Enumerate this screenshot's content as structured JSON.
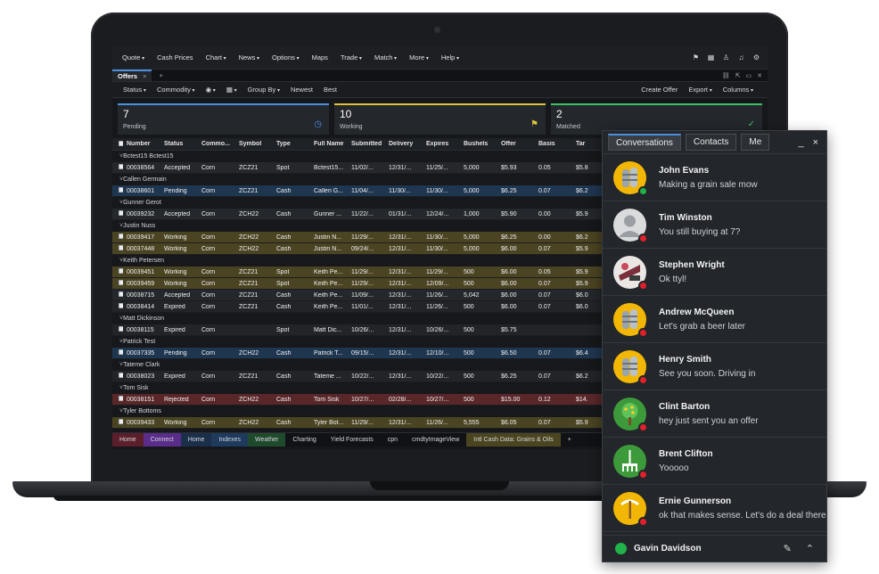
{
  "menu": [
    "Quote",
    "Cash Prices",
    "Chart",
    "News",
    "Options",
    "Maps",
    "Trade",
    "Match",
    "More",
    "Help"
  ],
  "menu_dropdown": [
    true,
    false,
    true,
    true,
    true,
    false,
    true,
    true,
    true,
    true
  ],
  "menu_icons": [
    "flag-icon",
    "grid-icon",
    "user-icon",
    "bell-icon",
    "gear-icon"
  ],
  "tab": {
    "label": "Offers",
    "close": "×",
    "add": "+"
  },
  "toolbar": {
    "left": [
      "Status",
      "Commodity",
      "◉",
      "▦",
      "Group By",
      "Newest",
      "Best"
    ],
    "left_dropdown": [
      true,
      true,
      true,
      true,
      true,
      false,
      false
    ],
    "right": [
      "Create Offer",
      "Export",
      "Columns"
    ],
    "right_dropdown": [
      false,
      true,
      true
    ]
  },
  "cards": [
    {
      "count": "7",
      "label": "Pending",
      "color": "#4a90e2",
      "icon": "clock-icon"
    },
    {
      "count": "10",
      "label": "Working",
      "color": "#d9c43a",
      "icon": "flag-icon"
    },
    {
      "count": "2",
      "label": "Matched",
      "color": "#3cbf6a",
      "icon": "check-circle-icon"
    }
  ],
  "columns": [
    "Number",
    "Status",
    "Commo...",
    "Symbol",
    "Type",
    "Full Name",
    "Submitted",
    "Delivery",
    "Expires",
    "Bushels",
    "Offer",
    "Basis",
    "Tar"
  ],
  "groups": [
    {
      "name": "Bctest15 Bctest15",
      "rows": [
        [
          "00038564",
          "Accepted",
          "Corn",
          "ZCZ21",
          "Spot",
          "Bctest15...",
          "11/02/...",
          "12/31/...",
          "11/25/...",
          "5,000",
          "$5.93",
          "0.05",
          "$5.8"
        ]
      ]
    },
    {
      "name": "Callen Germain",
      "rows": [
        [
          "00038601",
          "Pending",
          "Corn",
          "ZCZ21",
          "Cash",
          "Callen G...",
          "11/04/...",
          "11/30/...",
          "11/30/...",
          "5,000",
          "$6.25",
          "0.07",
          "$6.2"
        ]
      ]
    },
    {
      "name": "Gunner Gerot",
      "rows": [
        [
          "00039232",
          "Accepted",
          "Corn",
          "ZCH22",
          "Cash",
          "Gunner ...",
          "11/22/...",
          "01/31/...",
          "12/24/...",
          "1,000",
          "$5.90",
          "0.00",
          "$5.9"
        ]
      ]
    },
    {
      "name": "Justin Nuss",
      "rows": [
        [
          "00039417",
          "Working",
          "Corn",
          "ZCH22",
          "Cash",
          "Justin N...",
          "11/29/...",
          "12/31/...",
          "11/30/...",
          "5,000",
          "$6.25",
          "0.00",
          "$6.2"
        ],
        [
          "00037448",
          "Working",
          "Corn",
          "ZCH22",
          "Cash",
          "Justin N...",
          "09/24/...",
          "12/31/...",
          "11/30/...",
          "5,000",
          "$6.00",
          "0.07",
          "$5.9"
        ]
      ]
    },
    {
      "name": "Keith Petersen",
      "rows": [
        [
          "00039451",
          "Working",
          "Corn",
          "ZCZ21",
          "Spot",
          "Keith Pe...",
          "11/29/...",
          "12/31/...",
          "11/29/...",
          "500",
          "$6.00",
          "0.05",
          "$5.9"
        ],
        [
          "00039459",
          "Working",
          "Corn",
          "ZCZ21",
          "Spot",
          "Keith Pe...",
          "11/29/...",
          "12/31/...",
          "12/09/...",
          "500",
          "$6.00",
          "0.07",
          "$5.9"
        ],
        [
          "00038715",
          "Accepted",
          "Corn",
          "ZCZ21",
          "Cash",
          "Keith Pe...",
          "11/09/...",
          "12/31/...",
          "11/26/...",
          "5,042",
          "$6.00",
          "0.07",
          "$6.0"
        ],
        [
          "00038414",
          "Expired",
          "Corn",
          "ZCZ21",
          "Cash",
          "Keith Pe...",
          "11/01/...",
          "12/31/...",
          "11/26/...",
          "500",
          "$6.00",
          "0.07",
          "$6.0"
        ]
      ]
    },
    {
      "name": "Matt Dickinson",
      "rows": [
        [
          "00038115",
          "Expired",
          "Corn",
          "",
          "Spot",
          "Matt Dic...",
          "10/26/...",
          "12/31/...",
          "10/26/...",
          "500",
          "$5.75",
          "",
          ""
        ]
      ]
    },
    {
      "name": "Patrick Test",
      "rows": [
        [
          "00037335",
          "Pending",
          "Corn",
          "ZCH22",
          "Cash",
          "Patrick T...",
          "09/15/...",
          "12/31/...",
          "12/10/...",
          "500",
          "$6.50",
          "0.07",
          "$6.4"
        ]
      ]
    },
    {
      "name": "Tateme Clark",
      "rows": [
        [
          "00038023",
          "Expired",
          "Corn",
          "ZCZ21",
          "Cash",
          "Tateme ...",
          "10/22/...",
          "12/31/...",
          "10/22/...",
          "500",
          "$6.25",
          "0.07",
          "$6.2"
        ]
      ]
    },
    {
      "name": "Tom Sisk",
      "rows": [
        [
          "00038151",
          "Rejected",
          "Corn",
          "ZCH22",
          "Cash",
          "Tom Sisk",
          "10/27/...",
          "02/28/...",
          "10/27/...",
          "500",
          "$15.00",
          "0.12",
          "$14."
        ]
      ]
    },
    {
      "name": "Tyler Bottoms",
      "rows": [
        [
          "00039433",
          "Working",
          "Corn",
          "ZCH22",
          "Cash",
          "Tyler Bot...",
          "11/29/...",
          "12/31/...",
          "11/26/...",
          "5,555",
          "$6.05",
          "0.07",
          "$5.9"
        ]
      ]
    }
  ],
  "status_colors": {
    "Pending": "#1f3650",
    "Accepted": "#24272b",
    "Working": "#4b4422",
    "Matched": "#1d4230",
    "Expired": "#222428",
    "Rejected": "#5a2729"
  },
  "bottom_tabs": [
    {
      "label": "Home",
      "color": "#5b1f2b"
    },
    {
      "label": "Connect",
      "color": "#5a2d8a"
    },
    {
      "label": "Home",
      "color": "#1b2f4a"
    },
    {
      "label": "Indexes",
      "color": "#1e3a5c"
    },
    {
      "label": "Weather",
      "color": "#1f4a2c"
    },
    {
      "label": "Charting",
      "color": "#101215"
    },
    {
      "label": "Yield Forecasts",
      "color": "#101215"
    },
    {
      "label": "cpn",
      "color": "#101215"
    },
    {
      "label": "cmdtyImageView",
      "color": "#101215"
    },
    {
      "label": "Intl Cash Data: Grains & Oils",
      "color": "#4a4520"
    },
    {
      "label": "+",
      "color": "#101215"
    }
  ],
  "chat": {
    "tabs": [
      "Conversations",
      "Contacts",
      "Me"
    ],
    "window_icons": {
      "minimize": "_",
      "close": "×"
    },
    "conversations": [
      {
        "name": "John Evans",
        "message": "Making a grain sale mow",
        "avatar": "silo",
        "status": "#21b24a"
      },
      {
        "name": "Tim Winston",
        "message": "You still buying at 7?",
        "avatar": "person",
        "status": "#e0202a"
      },
      {
        "name": "Stephen Wright",
        "message": "Ok ttyl!",
        "avatar": "photo",
        "status": "#e0202a"
      },
      {
        "name": "Andrew McQueen",
        "message": "Let's grab a beer later",
        "avatar": "silo",
        "status": "#e0202a"
      },
      {
        "name": "Henry Smith",
        "message": "See you soon. Driving in",
        "avatar": "silo",
        "status": "#e0202a"
      },
      {
        "name": "Clint Barton",
        "message": "hey just sent you an offer",
        "avatar": "tree",
        "status": "#e0202a"
      },
      {
        "name": "Brent Clifton",
        "message": "Yooooo",
        "avatar": "rake",
        "status": "#e0202a"
      },
      {
        "name": "Ernie Gunnerson",
        "message": "ok that makes sense. Let's do a deal there",
        "avatar": "pick",
        "status": "#e0202a"
      }
    ],
    "me": {
      "name": "Gavin Davidson",
      "status": "#21b24a"
    }
  }
}
